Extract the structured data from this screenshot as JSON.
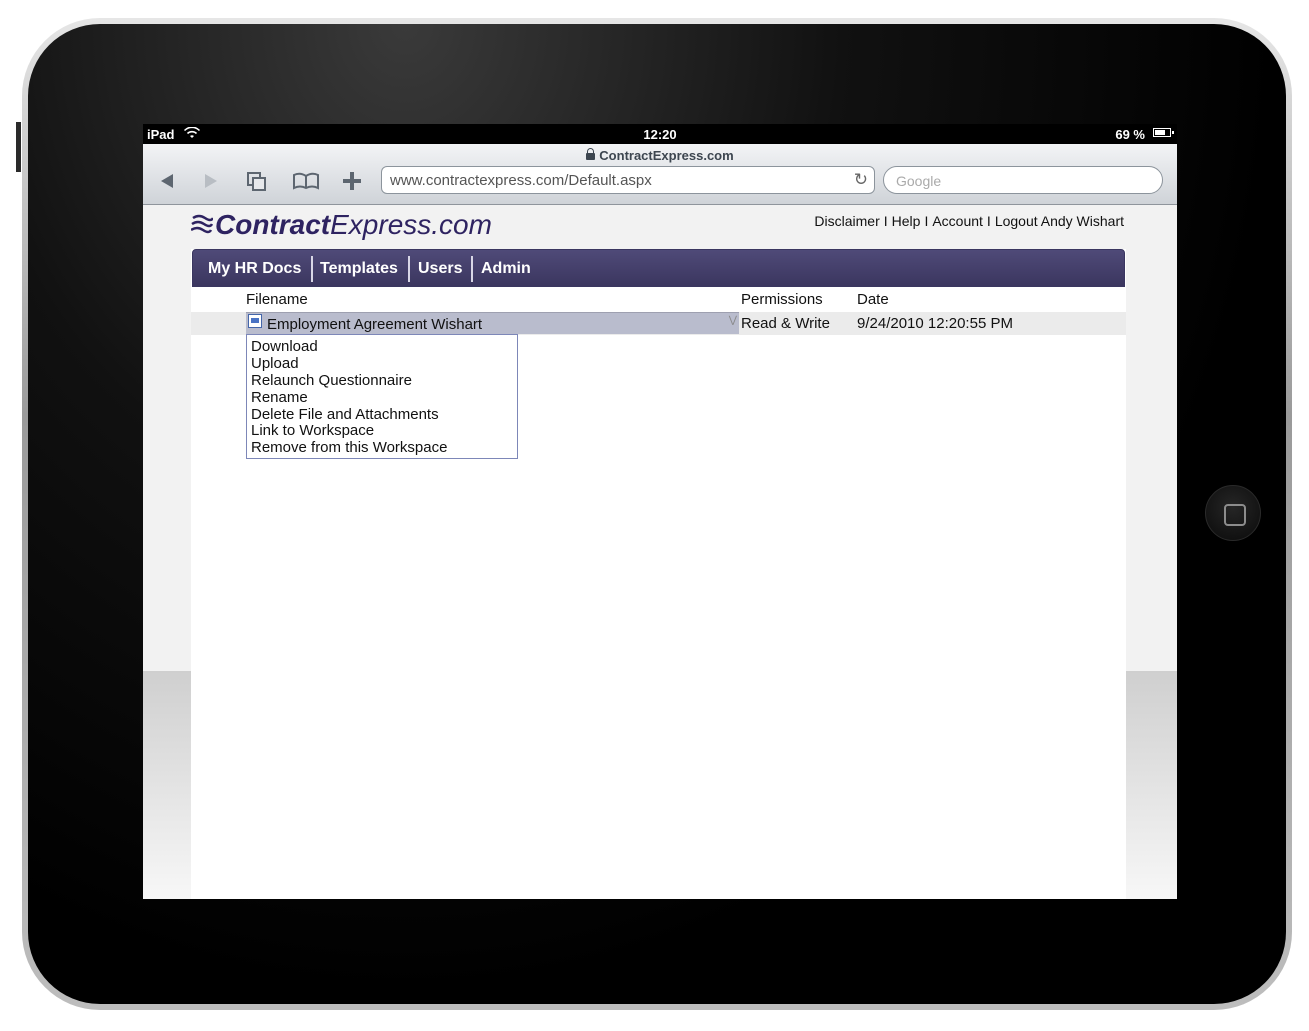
{
  "status_bar": {
    "device": "iPad",
    "time": "12:20",
    "battery": "69 %"
  },
  "browser": {
    "page_title": "ContractExpress.com",
    "url": "www.contractexpress.com/Default.aspx",
    "search_placeholder": "Google"
  },
  "site": {
    "logo_bold": "Contract",
    "logo_light": "Express.com",
    "top_links": [
      "Disclaimer",
      "Help",
      "Account",
      "Logout Andy Wishart"
    ],
    "separator": "I",
    "nav": [
      "My HR Docs",
      "Templates",
      "Users",
      "Admin"
    ]
  },
  "table": {
    "headers": {
      "filename": "Filename",
      "permissions": "Permissions",
      "date": "Date"
    },
    "row": {
      "filename": "Employment Agreement Wishart",
      "permissions": "Read & Write",
      "date": "9/24/2010 12:20:55 PM"
    }
  },
  "context_menu": [
    "Download",
    "Upload",
    "Relaunch Questionnaire",
    "Rename",
    "Delete File and Attachments",
    "Link to Workspace",
    "Remove from this Workspace"
  ],
  "colors": {
    "nav_bg": "#433e6a",
    "logo": "#2e2361",
    "selected_row": "#b9bccd"
  }
}
